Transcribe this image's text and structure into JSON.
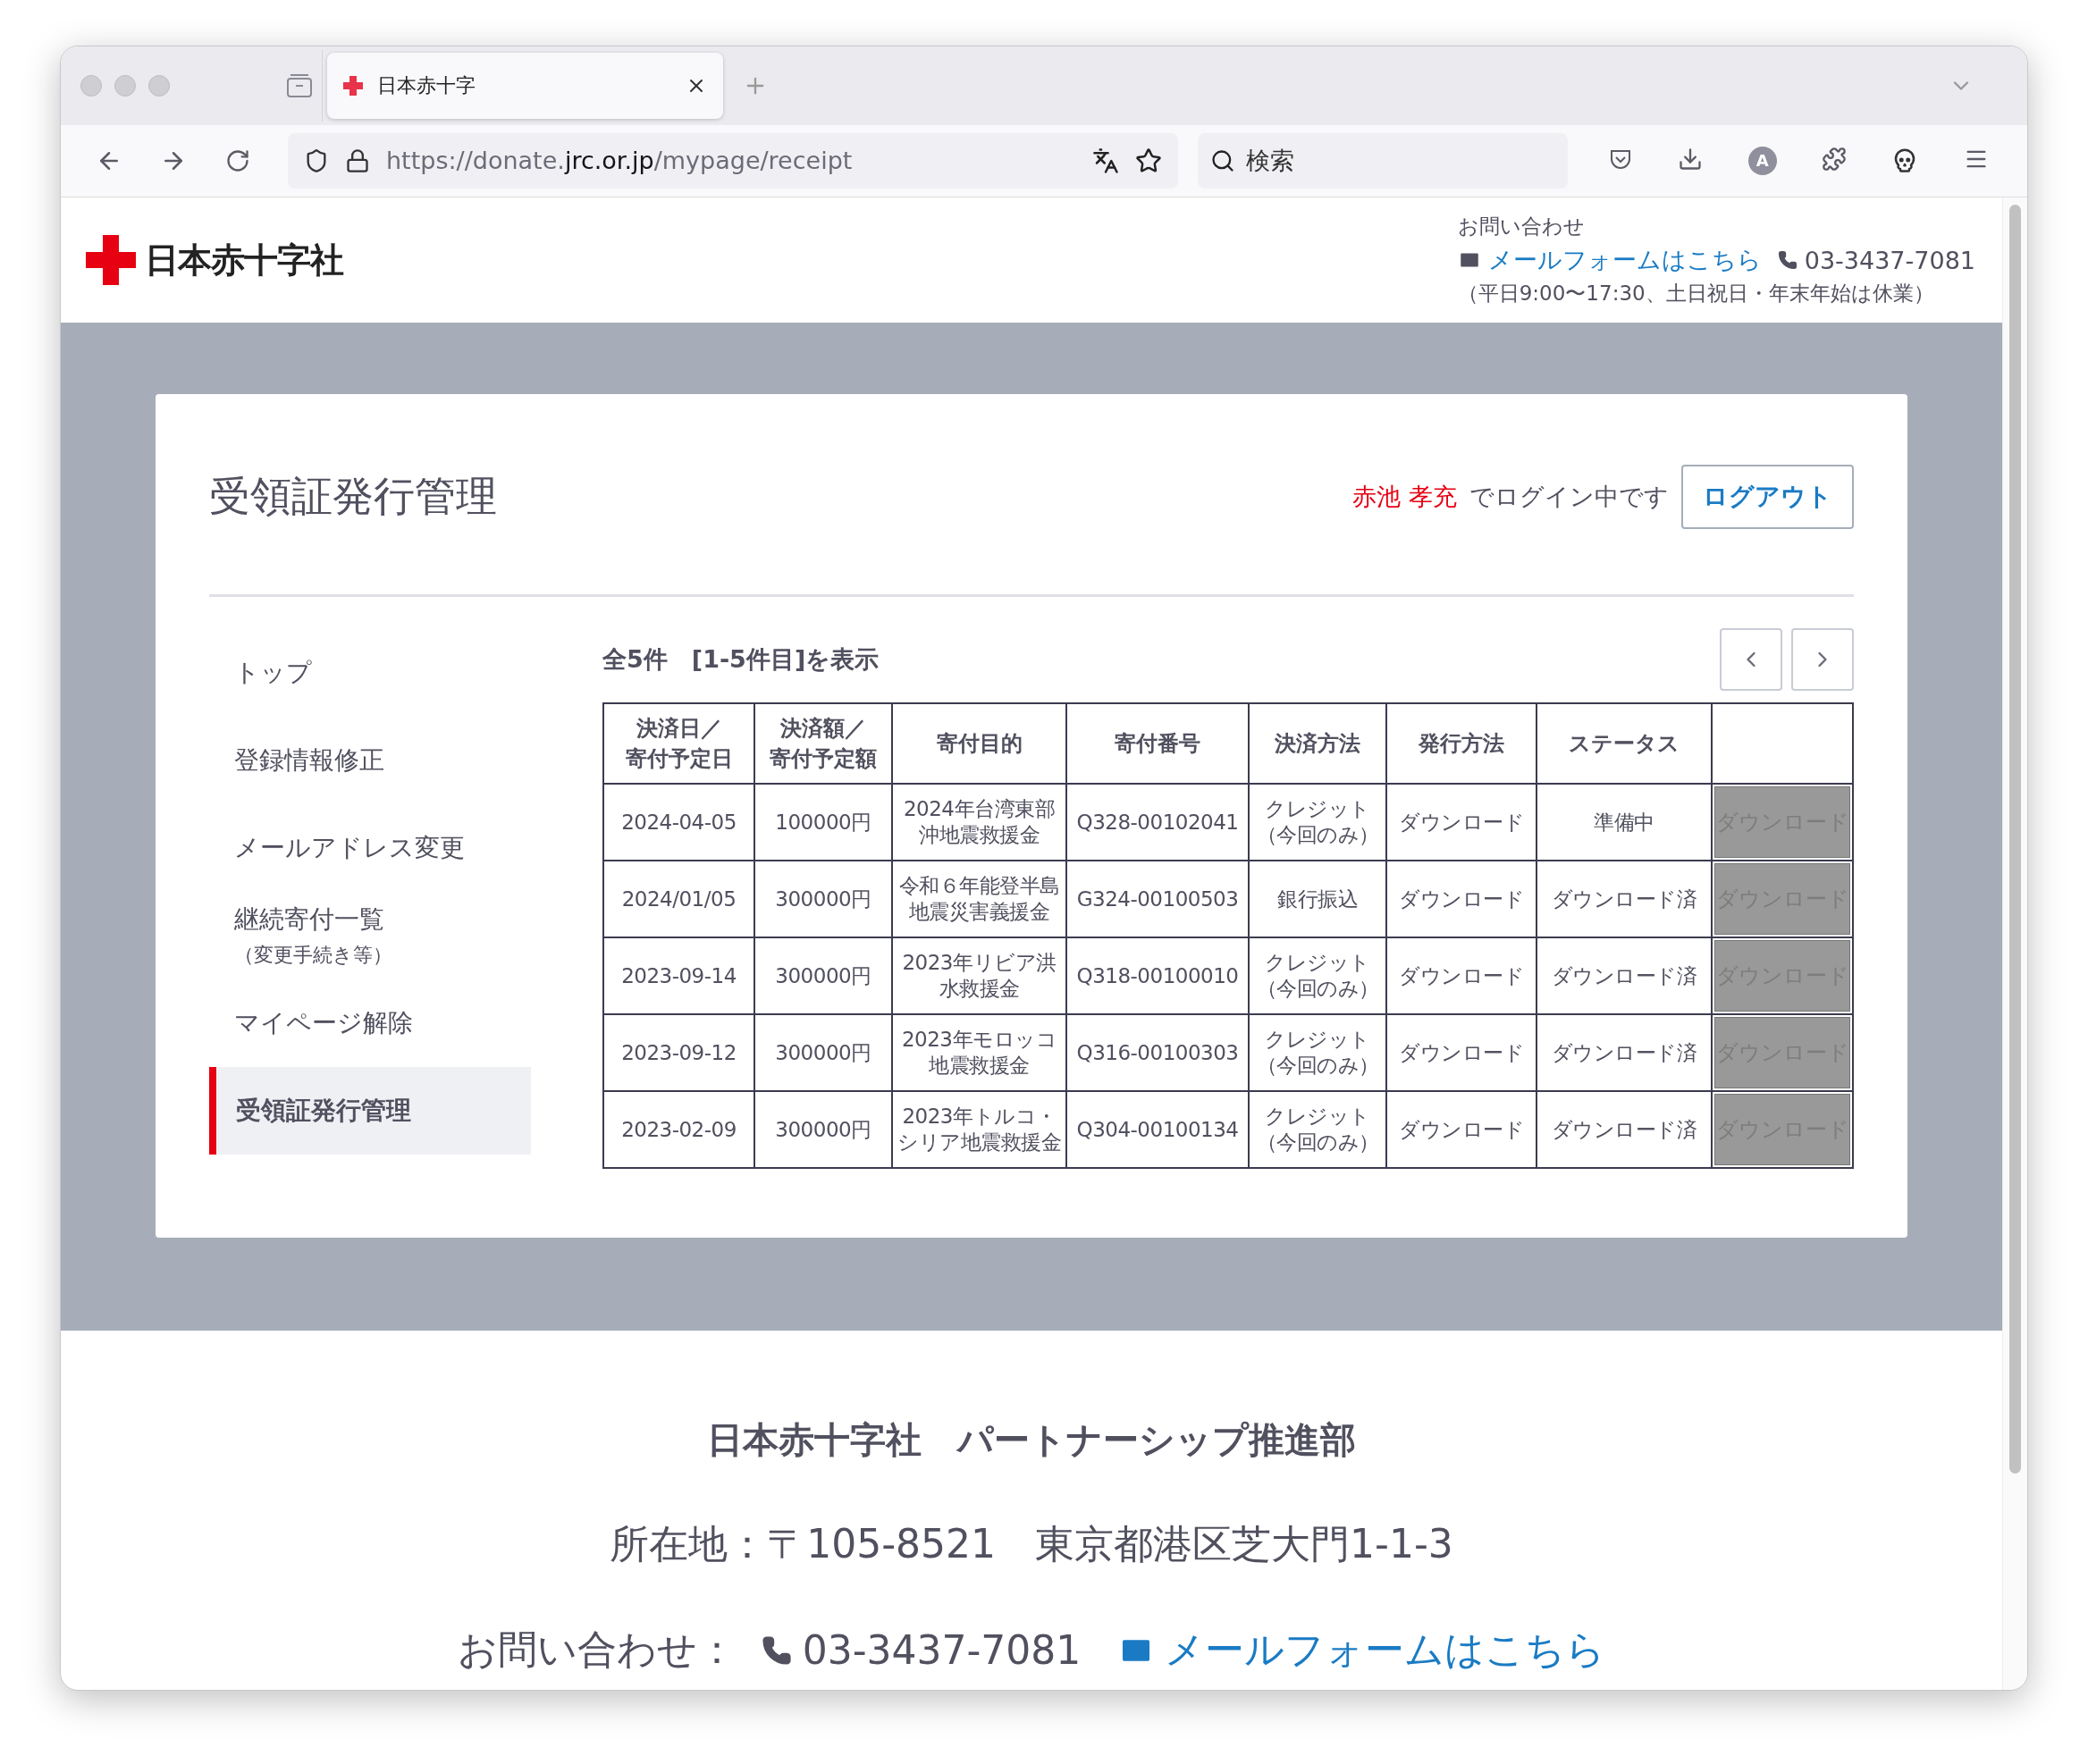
{
  "browser": {
    "tabs": [
      {
        "title": "日本赤十字",
        "selected": true
      }
    ],
    "url": {
      "prefix": "https://donate.",
      "domain": "jrc.or.jp",
      "path": "/mypage/receipt"
    },
    "search": {
      "placeholder": "検索"
    },
    "account_initial": "A"
  },
  "header": {
    "logo_text": "日本赤十字社",
    "contact_label": "お問い合わせ",
    "mail_link": "メールフォームはこちら",
    "phone": "03-3437-7081",
    "hours": "（平日9:00〜17:30、土日祝日・年末年始は休業）"
  },
  "main": {
    "title": "受領証発行管理",
    "user_name": "赤池 孝充",
    "login_text": "でログイン中です",
    "logout_button": "ログアウト"
  },
  "sidebar": {
    "items": [
      {
        "label": "トップ",
        "selected": false
      },
      {
        "label": "登録情報修正",
        "selected": false
      },
      {
        "label": "メールアドレス変更",
        "selected": false
      },
      {
        "label": "継続寄付一覧",
        "sub": "（変更手続き等）",
        "selected": false
      },
      {
        "label": "マイページ解除",
        "selected": false
      },
      {
        "label": "受領証発行管理",
        "selected": true
      }
    ]
  },
  "table": {
    "summary": "全5件　[1-5件目]を表示",
    "columns": [
      {
        "lines": [
          "決済日／",
          "寄付予定日"
        ]
      },
      {
        "lines": [
          "決済額／",
          "寄付予定額"
        ]
      },
      {
        "lines": [
          "寄付目的"
        ]
      },
      {
        "lines": [
          "寄付番号"
        ]
      },
      {
        "lines": [
          "決済方法"
        ]
      },
      {
        "lines": [
          "発行方法"
        ]
      },
      {
        "lines": [
          "ステータス"
        ]
      }
    ],
    "rows": [
      {
        "cells": [
          "2024-04-05",
          "100000円",
          [
            "2024年台湾東部",
            "沖地震救援金"
          ],
          "Q328-00102041",
          [
            "クレジット",
            "（今回のみ）"
          ],
          "ダウンロード",
          "準備中"
        ],
        "action": "ダウンロード",
        "disabled": true
      },
      {
        "cells": [
          "2024/01/05",
          "300000円",
          [
            "令和６年能登半島",
            "地震災害義援金"
          ],
          "G324-00100503",
          [
            "銀行振込"
          ],
          "ダウンロード",
          "ダウンロード済"
        ],
        "action": "ダウンロード",
        "disabled": true
      },
      {
        "cells": [
          "2023-09-14",
          "300000円",
          [
            "2023年リビア洪",
            "水救援金"
          ],
          "Q318-00100010",
          [
            "クレジット",
            "（今回のみ）"
          ],
          "ダウンロード",
          "ダウンロード済"
        ],
        "action": "ダウンロード",
        "disabled": true
      },
      {
        "cells": [
          "2023-09-12",
          "300000円",
          [
            "2023年モロッコ",
            "地震救援金"
          ],
          "Q316-00100303",
          [
            "クレジット",
            "（今回のみ）"
          ],
          "ダウンロード",
          "ダウンロード済"
        ],
        "action": "ダウンロード",
        "disabled": true
      },
      {
        "cells": [
          "2023-02-09",
          "300000円",
          [
            "2023年トルコ・",
            "シリア地震救援金"
          ],
          "Q304-00100134",
          [
            "クレジット",
            "（今回のみ）"
          ],
          "ダウンロード",
          "ダウンロード済"
        ],
        "action": "ダウンロード",
        "disabled": true
      }
    ]
  },
  "footer": {
    "org": "日本赤十字社　パートナーシップ推進部",
    "address": "所在地：〒105-8521　東京都港区芝大門1-1-3",
    "contact_label": "お問い合わせ：",
    "phone": "03-3437-7081",
    "mail_link": "メールフォームはこちら"
  }
}
